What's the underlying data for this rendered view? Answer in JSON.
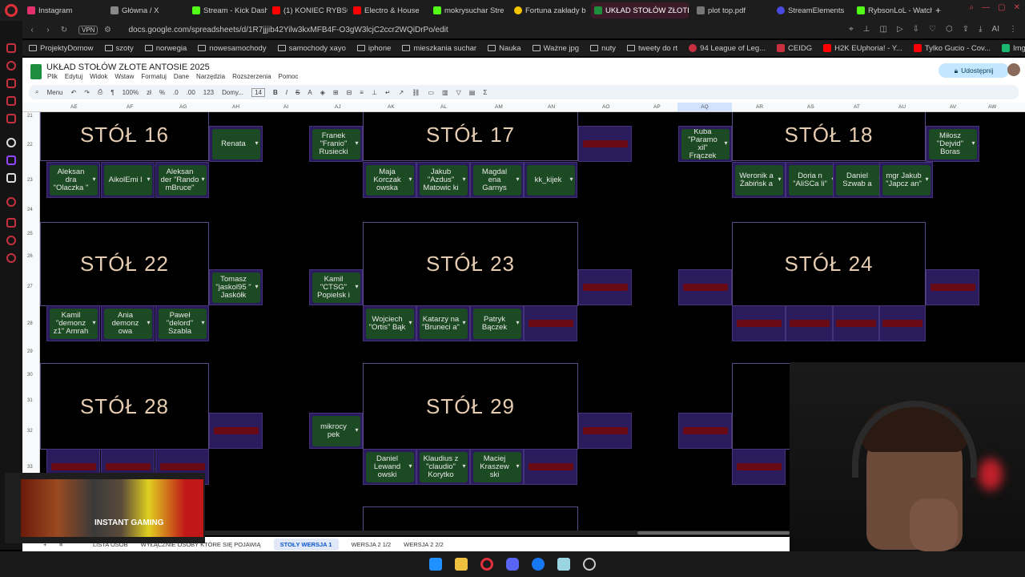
{
  "browser": {
    "tabs": [
      {
        "label": "Instagram",
        "color": "#e1306c"
      },
      {
        "label": "Główna / X",
        "color": "#888888"
      },
      {
        "label": "Stream - Kick Dash",
        "color": "#53fc18"
      },
      {
        "label": "(1) KONIEC RYBSO",
        "color": "#ff0000"
      },
      {
        "label": "Electro & House",
        "color": "#ff0000"
      },
      {
        "label": "mokrysuchar Stre",
        "color": "#53fc18"
      },
      {
        "label": "Fortuna zakłady b",
        "color": "#f5c400"
      },
      {
        "label": "UKŁAD STOŁÓW ZŁOTE A",
        "color": "#1e8e3e"
      },
      {
        "label": "plot top.pdf",
        "color": "#777777"
      },
      {
        "label": "StreamElements",
        "color": "#4a4ae0"
      },
      {
        "label": "RybsonLoL - Watch",
        "color": "#53fc18"
      }
    ],
    "new_tab": "+",
    "vpn": "VPN",
    "url": "docs.google.com/spreadsheets/d/1R7jjjib42Yilw3kxMFB4F-O3gW3lcjC2ccr2WQiDrPo/edit",
    "ai_label": "AI",
    "bookmarks": [
      "ProjektyDomow",
      "szoty",
      "norwegia",
      "nowesamochody",
      "samochody xayo",
      "iphone",
      "mieszkania suchar",
      "Nauka",
      "Ważne jpg",
      "nuty",
      "tweety do rt",
      "94 League of Leg...",
      "CEIDG",
      "H2K EUphoria! - Y...",
      "Tylko Gucio - Cov...",
      "Imgur: The most a..."
    ]
  },
  "docs": {
    "title": "UKŁAD STOŁÓW ZŁOTE ANTOSIE 2025",
    "menus": [
      "Plik",
      "Edytuj",
      "Widok",
      "Wstaw",
      "Formatuj",
      "Dane",
      "Narzędzia",
      "Rozszerzenia",
      "Pomoc"
    ],
    "share_label": "Udostępnij",
    "toolbar": {
      "menu": "Menu",
      "zoom": "100%",
      "currency": "zł",
      "percent": "%",
      "decimals_down": ".0",
      "decimals_up": ".00",
      "format": "123",
      "font": "Domy...",
      "font_size": "14"
    }
  },
  "columns": [
    "AE",
    "AF",
    "AG",
    "AH",
    "AI",
    "AJ",
    "AK",
    "AL",
    "AM",
    "AN",
    "AO",
    "AP",
    "AQ",
    "AR",
    "AS",
    "AT",
    "AU",
    "AV",
    "AW"
  ],
  "rows": [
    "21",
    "22",
    "23",
    "24",
    "25",
    "26",
    "27",
    "28",
    "29",
    "30",
    "31",
    "32",
    "33"
  ],
  "grid": {
    "tables": [
      "STÓŁ 16",
      "STÓŁ 17",
      "STÓŁ 18",
      "STÓŁ 22",
      "STÓŁ 23",
      "STÓŁ 24",
      "STÓŁ 28",
      "STÓŁ 29",
      "S"
    ],
    "seats": {
      "renata": "Renata",
      "franek": "Franek \"Franio\" Rusiecki",
      "kuba": "Kuba \"Paramo xil\" Frączek",
      "milosz": "Miłosz \"Dejvid\" Boras",
      "aleksandra": "Aleksan dra \"Olaczka \"",
      "aikol": "AikolEmi l",
      "aleksander": "Aleksan der \"Rando mBruce\"",
      "maja": "Maja Korczak owska",
      "jakub_azdus": "Jakub \"Azdus\" Matowic ki",
      "magdalena": "Magdal ena Garnys",
      "kk": "kk_kijek",
      "weronika": "Weronik a Żabińsk a",
      "doria": "Doria n \"AliSCa li\"",
      "daniel_sz": "Daniel Szwab a",
      "mgr_jakub": "mgr Jakub \"Japcz an\"",
      "tomasz": "Tomasz \"jaskol95 \" Jaskółk",
      "kamil_ctsg": "Kamil \"CTSG\" Popielsk i",
      "kamil_demonz": "Kamil \"demonz z1\" Amrah",
      "ania": "Ania demonz owa",
      "pawel": "Paweł \"delord\" Szabla",
      "wojciech": "Wojciech \"Ortis\" Bąk",
      "katarzyna": "Katarzy na \"Bruneci a\"",
      "patryk": "Patryk Bączek",
      "mikrocypek": "mikrocy pek",
      "daniel_l": "Daniel Lewand owski",
      "klaudius": "Klaudius z \"claudio\" Korytko",
      "maciej": "Maciej Kraszew ski"
    }
  },
  "sheet_tabs": [
    "LISTA OSÓB",
    "WYŁĄCZNIE OSOBY KTÓRE SIĘ POJAWIĄ",
    "STOŁY WERSJA 1",
    "WERSJA 2 1/2",
    "WERSJA 2 2/2"
  ],
  "active_sheet": "STOŁY WERSJA 1",
  "stream_overlay": {
    "label": "INSTANT GAMING"
  }
}
